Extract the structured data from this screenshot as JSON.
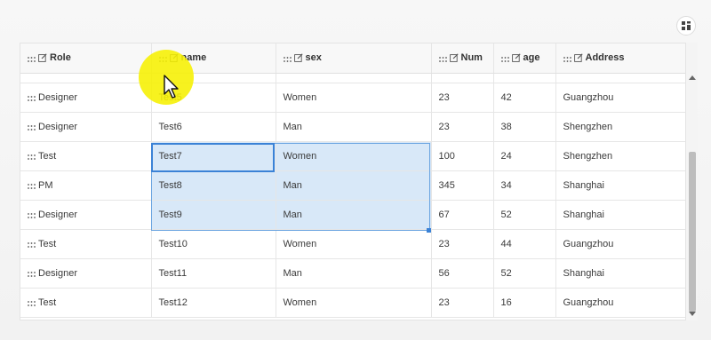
{
  "toolbar": {
    "layout_icon": "grid-layout-icon"
  },
  "columns": [
    {
      "label": "Role",
      "drag_icon": "drag-handle-icon",
      "edit_icon": "edit-icon"
    },
    {
      "label": "name",
      "drag_icon": "drag-handle-icon",
      "edit_icon": "edit-icon"
    },
    {
      "label": "sex",
      "drag_icon": "drag-handle-icon",
      "edit_icon": "edit-icon"
    },
    {
      "label": "Num",
      "drag_icon": "drag-handle-icon",
      "edit_icon": "edit-icon"
    },
    {
      "label": "age",
      "drag_icon": "drag-handle-icon",
      "edit_icon": "edit-icon"
    },
    {
      "label": "Address",
      "drag_icon": "drag-handle-icon",
      "edit_icon": "edit-icon"
    }
  ],
  "rows": [
    {
      "role": "Designer",
      "name": "Test5",
      "sex": "Women",
      "num": "23",
      "age": "42",
      "address": "Guangzhou"
    },
    {
      "role": "Designer",
      "name": "Test6",
      "sex": "Man",
      "num": "23",
      "age": "38",
      "address": "Shengzhen"
    },
    {
      "role": "Test",
      "name": "Test7",
      "sex": "Women",
      "num": "100",
      "age": "24",
      "address": "Shengzhen"
    },
    {
      "role": "PM",
      "name": "Test8",
      "sex": "Man",
      "num": "345",
      "age": "34",
      "address": "Shanghai"
    },
    {
      "role": "Designer",
      "name": "Test9",
      "sex": "Man",
      "num": "67",
      "age": "52",
      "address": "Shanghai"
    },
    {
      "role": "Test",
      "name": "Test10",
      "sex": "Women",
      "num": "23",
      "age": "44",
      "address": "Guangzhou"
    },
    {
      "role": "Designer",
      "name": "Test11",
      "sex": "Man",
      "num": "56",
      "age": "52",
      "address": "Shanghai"
    },
    {
      "role": "Test",
      "name": "Test12",
      "sex": "Women",
      "num": "23",
      "age": "16",
      "address": "Guangzhou"
    }
  ],
  "selection": {
    "rows": [
      "Test7",
      "Test8",
      "Test9"
    ],
    "columns": [
      "name",
      "sex"
    ],
    "active_cell": "Test7"
  },
  "colors": {
    "selection_fill": "#d8e8f8",
    "selection_border": "#3b82d6",
    "cursor_highlight": "#f6f000"
  }
}
